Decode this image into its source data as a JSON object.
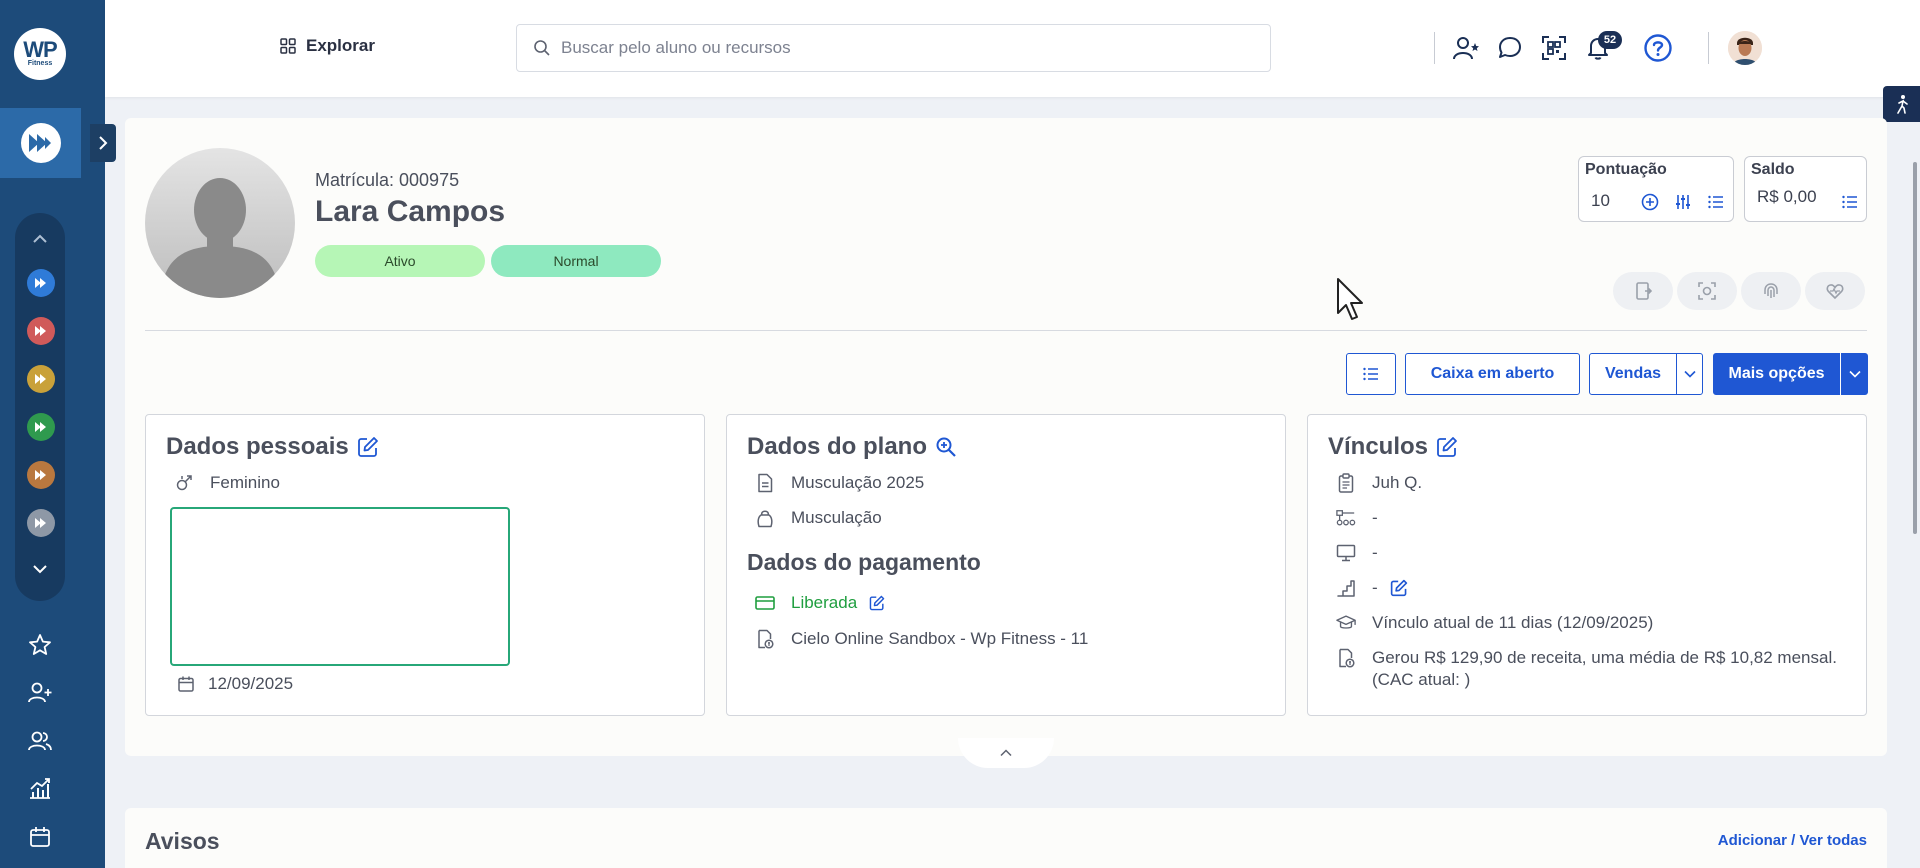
{
  "app": {
    "logo_top": "WP",
    "logo_bottom": "Fitness",
    "notification_count": "52"
  },
  "header": {
    "explore_label": "Explorar",
    "search_placeholder": "Buscar pelo aluno ou recursos"
  },
  "student": {
    "matricula": "Matrícula: 000975",
    "name": "Lara Campos",
    "status_badge": "Ativo",
    "risk_badge": "Normal",
    "points": {
      "title": "Pontuação",
      "value": "10"
    },
    "balance": {
      "title": "Saldo",
      "value": "R$ 0,00"
    }
  },
  "actions": {
    "caixa_label": "Caixa em aberto",
    "vendas_label": "Vendas",
    "more_label": "Mais opções"
  },
  "personal": {
    "title": "Dados pessoais",
    "gender": "Feminino",
    "date": "12/09/2025"
  },
  "plan": {
    "title": "Dados do plano",
    "plan_name": "Musculação 2025",
    "modality": "Musculação",
    "payment_title": "Dados do pagamento",
    "payment_status": "Liberada",
    "gateway": "Cielo Online Sandbox - Wp Fitness - 11"
  },
  "links": {
    "title": "Vínculos",
    "consultant": "Juh Q.",
    "item2": "-",
    "item3": "-",
    "item4": "-",
    "current_link": "Vínculo atual de 11 dias (12/09/2025)",
    "revenue": "Gerou R$ 129,90 de receita, uma média de R$ 10,82 mensal. (CAC atual: )"
  },
  "avisos": {
    "title": "Avisos",
    "link": "Adicionar / Ver todas"
  },
  "colors": {
    "sidebar": "#1d4b7a",
    "primary": "#1f57d3",
    "active_badge": "#b6f6b6",
    "normal_badge": "#8ee9bf",
    "payment_ok": "#1f9e3f",
    "unit_colors": [
      "#2f7bd8",
      "#d05a5a",
      "#c9a13a",
      "#2f9a4e",
      "#b9783f",
      "#8e98a6"
    ]
  },
  "icons": [
    "grid-icon",
    "search-icon",
    "add-user-icon",
    "chat-icon",
    "qr-code-icon",
    "bell-icon",
    "help-icon",
    "star-icon",
    "users-icon",
    "chart-icon",
    "calendar-icon",
    "edit-icon",
    "zoom-in-icon",
    "document-icon",
    "kettlebell-icon",
    "credit-card-icon",
    "receipt-icon",
    "clipboard-icon",
    "monitor-icon",
    "stairs-icon",
    "graduation-cap-icon",
    "gender-icon",
    "fingerprint-icon",
    "camera-icon",
    "heart-icon",
    "door-icon"
  ]
}
